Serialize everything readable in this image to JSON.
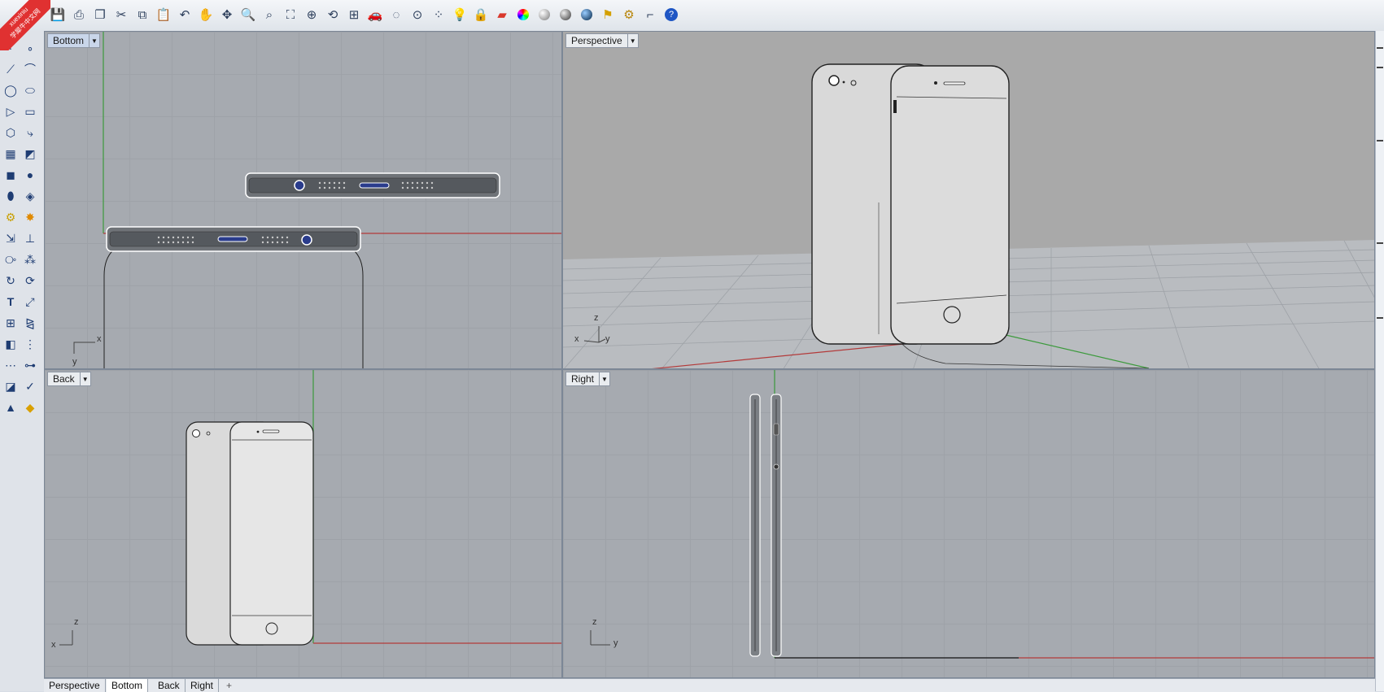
{
  "watermark": {
    "brand": "xuexiniu",
    "site": "学犀牛中文网"
  },
  "toolbar": {
    "icons": [
      "save-icon",
      "print-icon",
      "copy-to-icon",
      "cut-icon",
      "copy-icon",
      "paste-icon",
      "undo-icon",
      "pan-hand-icon",
      "move-view-icon",
      "zoom-icon",
      "zoom-window-icon",
      "zoom-extents-icon",
      "zoom-selected-icon",
      "rotate-view-icon",
      "four-viewports-icon",
      "car-icon",
      "hide-icon",
      "show-icon",
      "select-points-icon",
      "light-bulb-icon",
      "lock-icon",
      "render-icon",
      "color-wheel-icon",
      "material-sphere-icon",
      "shaded-sphere-icon",
      "render-sphere-icon",
      "flag-icon",
      "gear-settings-icon",
      "dimension-icon",
      "help-icon"
    ]
  },
  "viewports": {
    "bottom": {
      "label": "Bottom",
      "axis_x": "x",
      "axis_y": "y"
    },
    "perspective": {
      "label": "Perspective",
      "axis_x": "x",
      "axis_y": "y",
      "axis_z": "z"
    },
    "back": {
      "label": "Back",
      "axis_x": "x",
      "axis_z": "z"
    },
    "right": {
      "label": "Right",
      "axis_y": "y",
      "axis_z": "z"
    }
  },
  "tabs": [
    "Perspective",
    "Bottom",
    "Back",
    "Right"
  ],
  "active_tab": "Bottom",
  "add_tab_symbol": "+",
  "colors": {
    "x_axis": "#b33a3a",
    "y_axis": "#3c9a3c",
    "grid": "#9ea2a8",
    "grid_bg": "#a6aab0"
  }
}
